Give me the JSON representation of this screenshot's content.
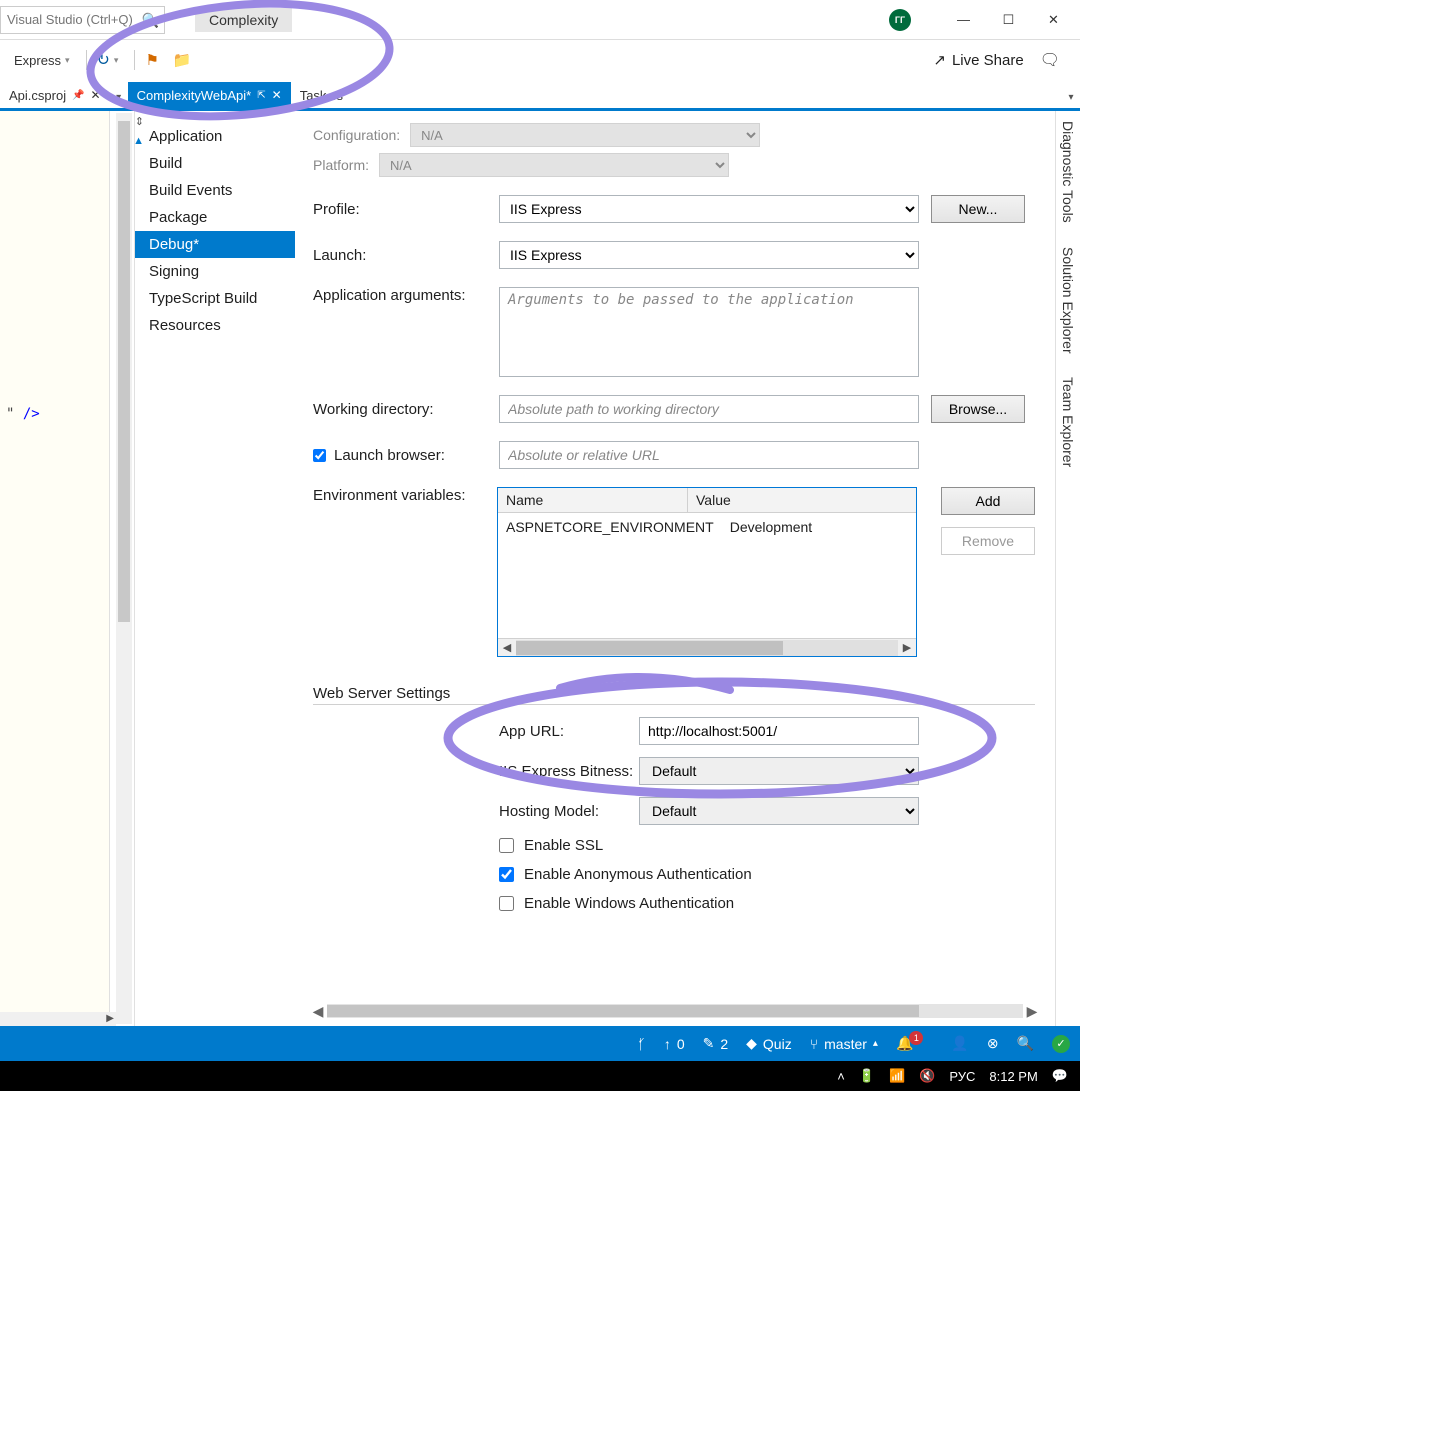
{
  "title_bar": {
    "search_placeholder": "Visual Studio (Ctrl+Q)",
    "solution_name": "Complexity",
    "avatar": "ГГ"
  },
  "toolbar": {
    "config_label": "Express",
    "live_share": "Live Share"
  },
  "tabs": {
    "left": "Api.csproj",
    "active": "ComplexityWebApi*",
    "right": "Task.cs"
  },
  "gutter_code": {
    "prefix": "\" ",
    "tag": "/>"
  },
  "prop_nav": [
    "Application",
    "Build",
    "Build Events",
    "Package",
    "Debug*",
    "Signing",
    "TypeScript Build",
    "Resources"
  ],
  "cfg": {
    "configuration_label": "Configuration:",
    "configuration_value": "N/A",
    "platform_label": "Platform:",
    "platform_value": "N/A"
  },
  "form": {
    "profile_label": "Profile:",
    "profile_value": "IIS Express",
    "new_btn": "New...",
    "launch_label": "Launch:",
    "launch_value": "IIS Express",
    "app_args_label": "Application arguments:",
    "app_args_placeholder": "Arguments to be passed to the application",
    "workdir_label": "Working directory:",
    "workdir_placeholder": "Absolute path to working directory",
    "browse_btn": "Browse...",
    "launch_browser_label": "Launch browser:",
    "launch_browser_placeholder": "Absolute or relative URL",
    "env_label": "Environment variables:",
    "env_name_head": "Name",
    "env_value_head": "Value",
    "env_row_name": "ASPNETCORE_ENVIRONMENT",
    "env_row_value": "Development",
    "add_btn": "Add",
    "remove_btn": "Remove"
  },
  "web": {
    "section": "Web Server Settings",
    "app_url_label": "App URL:",
    "app_url_value": "http://localhost:5001/",
    "bitness_label": "IIS Express Bitness:",
    "bitness_value": "Default",
    "hosting_label": "Hosting Model:",
    "hosting_value": "Default",
    "ssl_label": "Enable SSL",
    "anon_label": "Enable Anonymous Authentication",
    "winauth_label": "Enable Windows Authentication"
  },
  "side_tabs": [
    "Diagnostic Tools",
    "Solution Explorer",
    "Team Explorer"
  ],
  "vs_status": {
    "up_count": "0",
    "pencil_count": "2",
    "quiz": "Quiz",
    "branch": "master",
    "bell_badge": "1"
  },
  "taskbar": {
    "lang": "РУС",
    "time": "8:12 PM"
  }
}
